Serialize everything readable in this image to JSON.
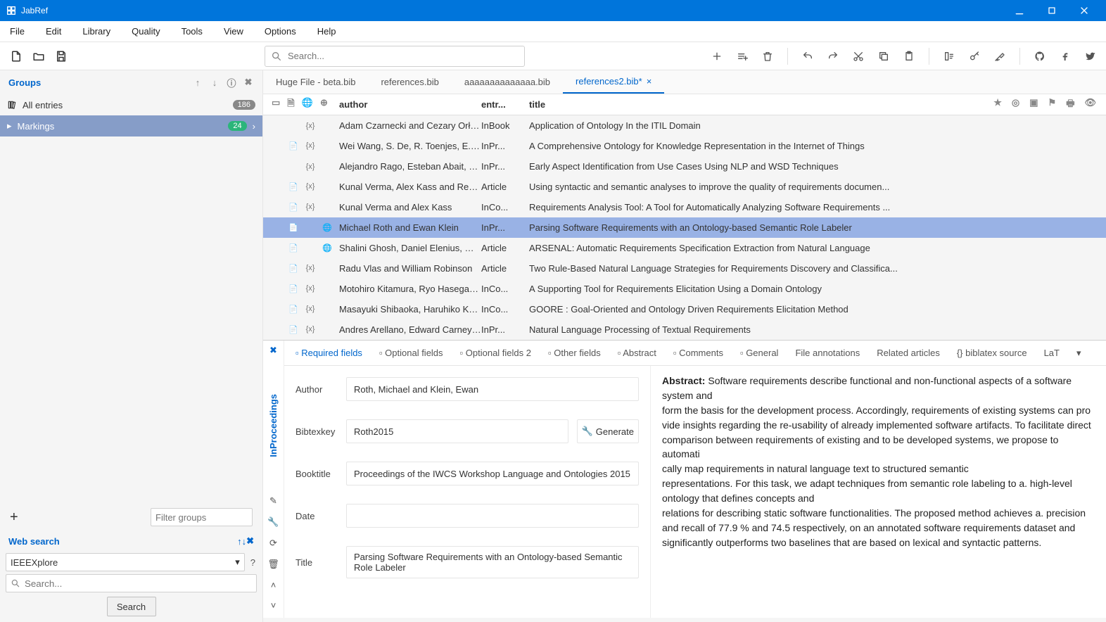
{
  "app": {
    "name": "JabRef"
  },
  "menu": [
    "File",
    "Edit",
    "Library",
    "Quality",
    "Tools",
    "View",
    "Options",
    "Help"
  ],
  "search": {
    "placeholder": "Search..."
  },
  "groups": {
    "title": "Groups",
    "allentries": {
      "label": "All entries",
      "count": "186"
    },
    "markings": {
      "label": "Markings",
      "count": "24"
    },
    "filter_placeholder": "Filter groups"
  },
  "websearch": {
    "title": "Web search",
    "engine": "IEEEXplore",
    "placeholder": "Search...",
    "button": "Search"
  },
  "tabs": [
    {
      "label": "Huge File - beta.bib",
      "active": false,
      "close": false
    },
    {
      "label": "references.bib",
      "active": false,
      "close": false
    },
    {
      "label": "aaaaaaaaaaaaaa.bib",
      "active": false,
      "close": false
    },
    {
      "label": "references2.bib*",
      "active": true,
      "close": true
    }
  ],
  "columns": {
    "author": "author",
    "type": "entr...",
    "title": "title"
  },
  "entries": [
    {
      "file": "",
      "bib": "{x}",
      "web": "",
      "author": "Adam Czarnecki and Cezary Orłowski",
      "type": "InBook",
      "title": "Application of Ontology In the ITIL Domain"
    },
    {
      "file": "📄",
      "bib": "{x}",
      "web": "",
      "author": "Wei Wang, S. De, R. Toenjes, E. Ree...",
      "type": "InPr...",
      "title": "A Comprehensive Ontology for Knowledge Representation in the Internet of Things"
    },
    {
      "file": "",
      "bib": "{x}",
      "web": "",
      "author": "Alejandro Rago, Esteban Abait, Cla...",
      "type": "InPr...",
      "title": "Early Aspect Identification from Use Cases Using NLP and WSD Techniques"
    },
    {
      "file": "📄",
      "bib": "{x}",
      "web": "",
      "author": "Kunal Verma, Alex Kass and Reymo...",
      "type": "Article",
      "title": "Using syntactic and semantic analyses to improve the quality of requirements documen..."
    },
    {
      "file": "📄",
      "bib": "{x}",
      "web": "",
      "author": "Kunal Verma and Alex Kass",
      "type": "InCo...",
      "title": "Requirements Analysis Tool: A Tool for Automatically Analyzing Software Requirements ..."
    },
    {
      "file": "📄",
      "bib": "",
      "web": "🌐",
      "author": "Michael Roth and Ewan Klein",
      "type": "InPr...",
      "title": "Parsing Software Requirements with an Ontology-based Semantic Role Labeler",
      "selected": true
    },
    {
      "file": "📄",
      "bib": "",
      "web": "🌐",
      "author": "Shalini Ghosh, Daniel Elenius, Wenc...",
      "type": "Article",
      "title": "ARSENAL: Automatic Requirements Specification Extraction from Natural Language"
    },
    {
      "file": "📄",
      "bib": "{x}",
      "web": "",
      "author": "Radu Vlas and William Robinson",
      "type": "Article",
      "title": "Two Rule-Based Natural Language Strategies for Requirements Discovery and Classifica..."
    },
    {
      "file": "📄",
      "bib": "{x}",
      "web": "",
      "author": "Motohiro Kitamura, Ryo Hasegawa,...",
      "type": "InCo...",
      "title": "A Supporting Tool for Requirements Elicitation Using a Domain Ontology"
    },
    {
      "file": "📄",
      "bib": "{x}",
      "web": "",
      "author": "Masayuki Shibaoka, Haruhiko Kaiya...",
      "type": "InCo...",
      "title": "GOORE : Goal-Oriented and Ontology Driven Requirements Elicitation Method"
    },
    {
      "file": "📄",
      "bib": "{x}",
      "web": "",
      "author": "Andres Arellano, Edward Carney an...",
      "type": "InPr...",
      "title": "Natural Language Processing of Textual Requirements"
    }
  ],
  "editor": {
    "type_label": "InProceedings",
    "tabs": [
      "Required fields",
      "Optional fields",
      "Optional fields 2",
      "Other fields",
      "Abstract",
      "Comments",
      "General",
      "File annotations",
      "Related articles",
      "biblatex source",
      "LaT"
    ],
    "fields": {
      "author_label": "Author",
      "author": "Roth, Michael and Klein, Ewan",
      "bibtexkey_label": "Bibtexkey",
      "bibtexkey": "Roth2015",
      "generate": "Generate",
      "booktitle_label": "Booktitle",
      "booktitle": "Proceedings of the IWCS Workshop Language and Ontologies 2015",
      "date_label": "Date",
      "date": "",
      "title_label": "Title",
      "title": "Parsing Software Requirements with an Ontology-based Semantic Role Labeler"
    },
    "abstract_label": "Abstract:",
    "abstract_body": " Software requirements describe functional and non-functional aspects of a software system and\nform the basis for the development process. Accordingly, requirements of existing systems can pro\nvide insights regarding the re-usability of already implemented software artifacts. To facilitate direct\ncomparison between requirements of existing and to be developed systems, we propose to automati\ncally map requirements in natural language text to structured semantic\nrepresentations. For this task, we adapt techniques from semantic role labeling to a. high-level ontology that defines concepts and\nrelations for describing static software functionalities. The proposed method achieves a. precision and recall of 77.9 % and 74.5 respectively, on an annotated software requirements dataset and\nsignificantly outperforms two baselines that are based on lexical and syntactic patterns."
  }
}
